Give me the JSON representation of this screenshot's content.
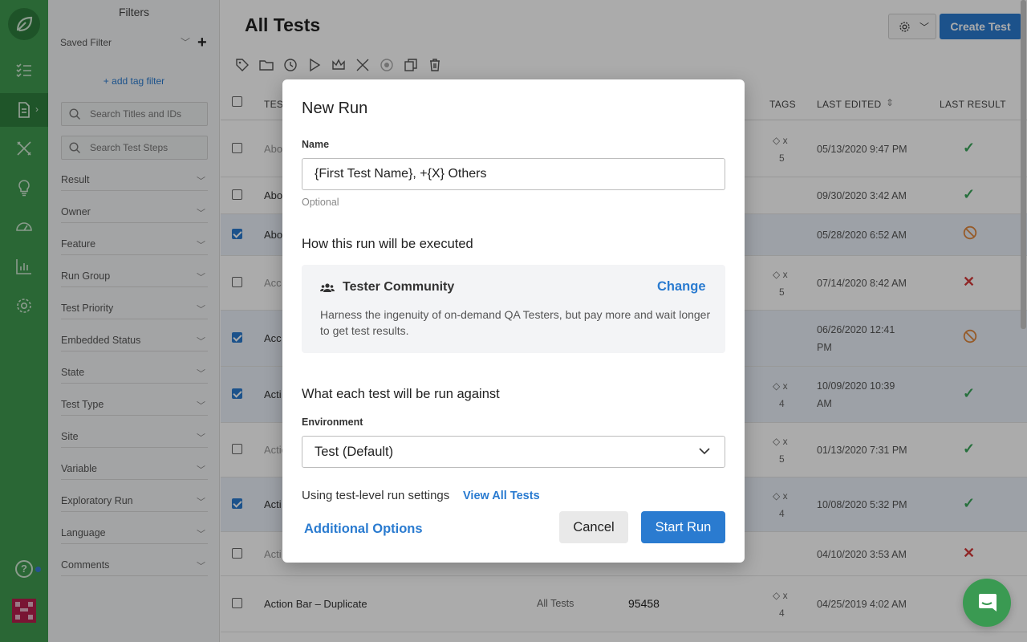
{
  "filters": {
    "title": "Filters",
    "saved_filter": "Saved Filter",
    "add_symbol": "+",
    "add_tag_filter": "+ add tag filter",
    "search_titles_placeholder": "Search Titles and IDs",
    "search_steps_placeholder": "Search Test Steps",
    "facets": [
      "Result",
      "Owner",
      "Feature",
      "Run Group",
      "Test Priority",
      "Embedded Status",
      "State",
      "Test Type",
      "Site",
      "Variable",
      "Exploratory Run",
      "Language",
      "Comments"
    ]
  },
  "main": {
    "title": "All Tests",
    "create_button": "Create Test",
    "columns": {
      "test": "TEST",
      "tags": "TAGS",
      "last_edited": "LAST EDITED",
      "last_result": "LAST RESULT"
    },
    "rows": [
      {
        "name": "Abo",
        "dim": true,
        "checked": false,
        "tag": "x",
        "tag_count": "5",
        "edited": "05/13/2020 9:47 PM",
        "result": "pass"
      },
      {
        "name": "Abo",
        "dim": false,
        "checked": false,
        "tag": "",
        "tag_count": "",
        "edited": "09/30/2020 3:42 AM",
        "result": "pass"
      },
      {
        "name": "Abo",
        "dim": false,
        "checked": true,
        "tag": "",
        "tag_count": "",
        "edited": "05/28/2020 6:52 AM",
        "result": "skip"
      },
      {
        "name": "Acc",
        "dim": true,
        "checked": false,
        "tag": "x",
        "tag_count": "5",
        "edited": "07/14/2020 8:42 AM",
        "result": "fail"
      },
      {
        "name": "Acc",
        "dim": false,
        "checked": true,
        "tag": "",
        "tag_count": "",
        "edited": "06/26/2020 12:41",
        "edited2": "PM",
        "result": "skip"
      },
      {
        "name": "Acti",
        "dim": false,
        "checked": true,
        "tag": "x",
        "tag_count": "4",
        "edited": "10/09/2020 10:39",
        "edited2": "AM",
        "result": "pass"
      },
      {
        "name": "Actio",
        "dim": true,
        "checked": false,
        "tag": "x",
        "tag_count": "5",
        "edited": "01/13/2020 7:31 PM",
        "result": "pass"
      },
      {
        "name": "Acti",
        "dim": false,
        "checked": true,
        "tag": "x",
        "tag_count": "4",
        "edited": "10/08/2020 5:32 PM",
        "result": "pass"
      },
      {
        "name": "Acti",
        "dim": true,
        "checked": false,
        "tag": "",
        "tag_count": "",
        "edited": "04/10/2020 3:53 AM",
        "result": "fail"
      },
      {
        "name": "Action Bar – Duplicate",
        "dim": false,
        "checked": false,
        "tag": "x",
        "tag_count": "4",
        "edited": "04/25/2019 4:02 AM",
        "result": "",
        "folder": "All Tests",
        "id": "95458"
      }
    ]
  },
  "modal": {
    "title": "New Run",
    "name_label": "Name",
    "name_value": "{First Test Name}, +{X} Others",
    "optional": "Optional",
    "execution_heading": "How this run will be executed",
    "method_title": "Tester Community",
    "change_link": "Change",
    "method_desc": "Harness the ingenuity of on-demand QA Testers, but pay more and wait longer to get test results.",
    "target_heading": "What each test will be run against",
    "env_label": "Environment",
    "env_value": "Test (Default)",
    "settings_text": "Using test-level run settings",
    "view_all": "View All Tests",
    "additional_options": "Additional Options",
    "cancel": "Cancel",
    "start": "Start Run"
  },
  "colors": {
    "rail": "#3f9a4f",
    "accent": "#2a7bd0",
    "pass": "#3aa65a",
    "fail": "#d63b3b",
    "skip": "#e0873c"
  }
}
